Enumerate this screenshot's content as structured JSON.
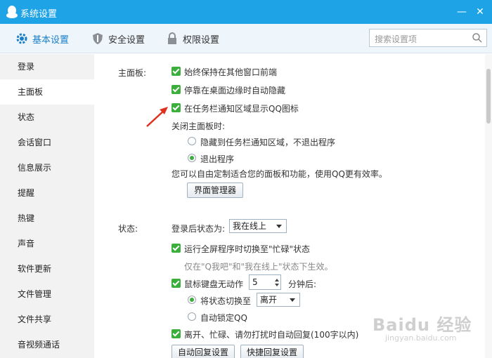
{
  "window": {
    "title": "系统设置",
    "minimize": "—",
    "close": "✕"
  },
  "tabs": [
    {
      "label": "基本设置",
      "icon": "gear-icon"
    },
    {
      "label": "安全设置",
      "icon": "shield-icon"
    },
    {
      "label": "权限设置",
      "icon": "lock-icon"
    }
  ],
  "search": {
    "placeholder": "搜索设置项"
  },
  "sidebar": {
    "items": [
      {
        "label": "登录"
      },
      {
        "label": "主面板"
      },
      {
        "label": "状态"
      },
      {
        "label": "会话窗口"
      },
      {
        "label": "信息展示"
      },
      {
        "label": "提醒"
      },
      {
        "label": "热键"
      },
      {
        "label": "声音"
      },
      {
        "label": "软件更新"
      },
      {
        "label": "文件管理"
      },
      {
        "label": "文件共享"
      },
      {
        "label": "音视频通话"
      }
    ],
    "active": "主面板"
  },
  "panel": {
    "section_label": "主面板:",
    "options": [
      "始终保持在其他窗口前端",
      "停靠在桌面边缘时自动隐藏",
      "在任务栏通知区域显示QQ图标"
    ],
    "close_label": "关闭主面板时:",
    "close_options": [
      {
        "label": "隐藏到任务栏通知区域，不退出程序",
        "selected": false
      },
      {
        "label": "退出程序",
        "selected": true
      }
    ],
    "custom_text": "您可以自由定制适合您的面板和功能，使用QQ更有效率。",
    "manager_button": "界面管理器"
  },
  "status": {
    "section_label": "状态:",
    "after_login_label": "登录后状态为:",
    "after_login_value": "我在线上",
    "fullscreen_option": "运行全屏程序时切换至\"忙碌\"状态",
    "fullscreen_hint": "仅在\"Q我吧\"和\"我在线上\"状态下生效。",
    "idle_label": "鼠标键盘无动作",
    "idle_minutes": "5",
    "idle_suffix": "分钟后:",
    "switch_label": "将状态切换至",
    "switch_value": "离开",
    "autolock_label": "自动锁定QQ",
    "autoreply_option": "离开、忙碌、请勿打扰时自动回复(100字以内)",
    "autoreply_button": "自动回复设置",
    "quickreply_button": "快捷回复设置"
  },
  "watermark": {
    "main": "Baidu 经验",
    "sub": "jingyan.baidu.com"
  }
}
